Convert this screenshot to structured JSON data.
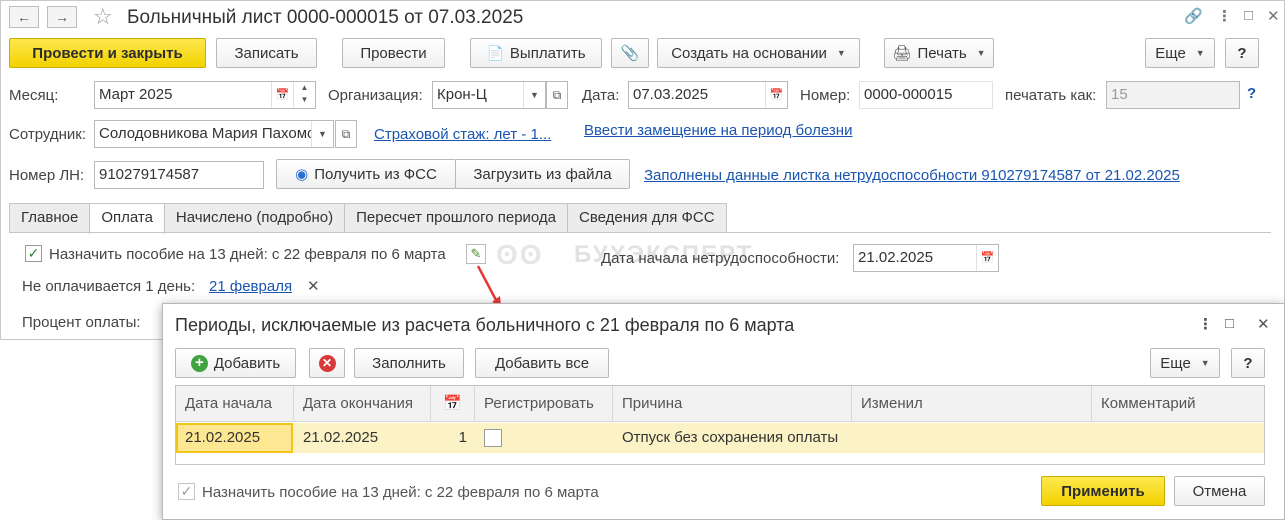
{
  "window": {
    "title": "Больничный лист 0000-000015 от 07.03.2025",
    "back_icon": "arrow-left-icon",
    "forward_icon": "arrow-right-icon",
    "favorite_icon": "star-icon",
    "link_icon": "chain-link-icon",
    "menu_icon": "more-vertical-icon",
    "maximize_icon": "maximize-icon",
    "close_icon": "close-icon"
  },
  "toolbar": {
    "post_close": "Провести и закрыть",
    "save": "Записать",
    "post": "Провести",
    "pay": "Выплатить",
    "create_based": "Создать на основании",
    "print": "Печать",
    "more": "Еще",
    "help": "?"
  },
  "form": {
    "month_label": "Месяц:",
    "month_value": "Март 2025",
    "org_label": "Организация:",
    "org_value": "Крон-Ц",
    "date_label": "Дата:",
    "date_value": "07.03.2025",
    "number_label": "Номер:",
    "number_value": "0000-000015",
    "print_as_label": "печатать как:",
    "print_as_value": "15",
    "help_mark": "?",
    "employee_label": "Сотрудник:",
    "employee_value": "Солодовникова Мария Пахомовна",
    "insurance_link": "Страховой стаж: лет - 1...",
    "replacement_link": "Ввести замещение на период болезни",
    "ln_label": "Номер ЛН:",
    "ln_value": "910279174587",
    "get_fss": "Получить из ФСС",
    "load_file": "Загрузить из файла",
    "filled_link": "Заполнены данные листка нетрудоспособности 910279174587 от 21.02.2025"
  },
  "tabs": [
    {
      "label": "Главное"
    },
    {
      "label": "Оплата"
    },
    {
      "label": "Начислено (подробно)"
    },
    {
      "label": "Пересчет прошлого периода"
    },
    {
      "label": "Сведения для ФСС"
    }
  ],
  "payment": {
    "assign_text": "Назначить пособие на 13 дней: с 22 февраля по 6 марта",
    "disability_start_label": "Дата начала нетрудоспособности:",
    "disability_start_value": "21.02.2025",
    "unpaid_label": "Не оплачивается 1 день:",
    "unpaid_link": "21 февраля",
    "remove_mark": "✕",
    "percent_label": "Процент оплаты:"
  },
  "watermark": "БУХЭКСПЕРТ",
  "dialog": {
    "title": "Периоды, исключаемые из расчета больничного с 21 февраля по 6 марта",
    "add": "Добавить",
    "fill": "Заполнить",
    "add_all": "Добавить все",
    "more": "Еще",
    "help": "?",
    "columns": [
      "Дата начала",
      "Дата окончания",
      "",
      "Регистрировать",
      "Причина",
      "Изменил",
      "Комментарий"
    ],
    "rows": [
      {
        "start": "21.02.2025",
        "end": "21.02.2025",
        "days": "1",
        "register": false,
        "reason": "Отпуск без сохранения оплаты",
        "changed": "",
        "comment": ""
      }
    ],
    "footer_check": "Назначить пособие  на 13 дней: с 22 февраля по 6 марта",
    "apply": "Применить",
    "cancel": "Отмена"
  },
  "colors": {
    "primary_button": "#f2d200",
    "link": "#1a55b0",
    "selected_row": "#fbf3c6",
    "arrow": "#e53935"
  }
}
